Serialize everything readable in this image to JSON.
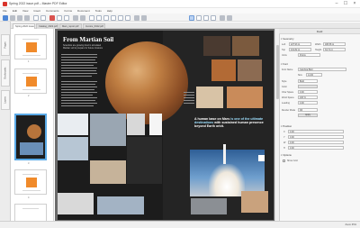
{
  "window": {
    "title": "Spring 2022 issue.pdf – Master PDF Editor",
    "controls": [
      "minimize-icon",
      "maximize-icon",
      "close-icon"
    ]
  },
  "menu": [
    "File",
    "Edit",
    "View",
    "Insert",
    "Comments",
    "Forms",
    "Document",
    "Tools",
    "Help"
  ],
  "tabs": [
    {
      "label": "Spring 2022 issue.pdf"
    },
    {
      "label": "Catalog_2022.pdf"
    },
    {
      "label": "Mars_report.pdf"
    },
    {
      "label": "Invoice_0042.pdf"
    }
  ],
  "rail": [
    "Pages",
    "Bookmarks",
    "Layers",
    "Search"
  ],
  "thumbnails": {
    "pages": [
      "1",
      "2",
      "3",
      "4",
      "5",
      "6",
      "7",
      "8"
    ]
  },
  "document": {
    "title": "From Martian Soil",
    "subtitle_1": "Scientists are growing food in simulated",
    "subtitle_2": "Martian soil to prepare for future missions",
    "quote_part1": "A human base on Mars ",
    "quote_highlight": "is one of the ultimate destinations",
    "quote_part2": " with sustained human presence beyond Earth orbit."
  },
  "panel": {
    "title": "Field",
    "general": {
      "heading": "Geometry",
      "left_label": "Left",
      "left_value": "227.93 pt",
      "width_label": "Width",
      "width_value": "180.58 pt",
      "top_label": "Top",
      "top_value": "101.82 pt",
      "height_label": "Height",
      "height_value": "34.71 pt",
      "units_label": "Units",
      "units_value": "Points",
      "lock_label": "Lock"
    },
    "font": {
      "heading": "Font",
      "name_label": "Font Name",
      "name_value": "Cambria Bold",
      "size_label": "Size",
      "size_value": "14.00",
      "color_label": "Color",
      "style_label": "Style",
      "style_value": "Bold",
      "rise_label": "Char Space",
      "rise_value": "0.00",
      "h_scale_label": "Word Space",
      "h_scale_value": "100 %",
      "leading_label": "Leading",
      "leading_value": "0.00",
      "render_label": "Render Mode",
      "render_value": "Fill",
      "apply_button": "Apply"
    },
    "position": {
      "heading": "Position",
      "x_label": "X",
      "x_value": "0.00",
      "y_label": "Y",
      "y_value": "0.00",
      "w_label": "W",
      "w_value": "0.00",
      "h_label": "H",
      "h_value": "0.00"
    },
    "options": {
      "heading": "Options",
      "show_label": "Show Grid"
    }
  },
  "status": {
    "zoom": "Zoom 65%"
  },
  "colors": {
    "accent": "#5aa9e6",
    "thumb_orange": "#f08a2a",
    "page_dark": "#1c1c1c"
  }
}
